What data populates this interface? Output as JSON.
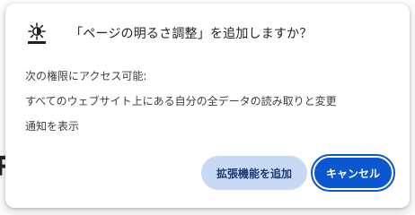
{
  "dialog": {
    "title": "「ページの明るさ調整」を追加しますか？",
    "icon": "brightness-sun-icon",
    "permissions_heading": "次の権限にアクセス可能:",
    "permissions": [
      "すべてのウェブサイト上にある自分の全データの読み取りと変更",
      "通知を表示"
    ],
    "buttons": {
      "add_label": "拡張機能を追加",
      "cancel_label": "キャンセル"
    }
  },
  "backdrop": {
    "partial_glyph": "R"
  },
  "colors": {
    "primary": "#0b57d0",
    "tonal": "#c7d9f5",
    "text": "#202124"
  }
}
